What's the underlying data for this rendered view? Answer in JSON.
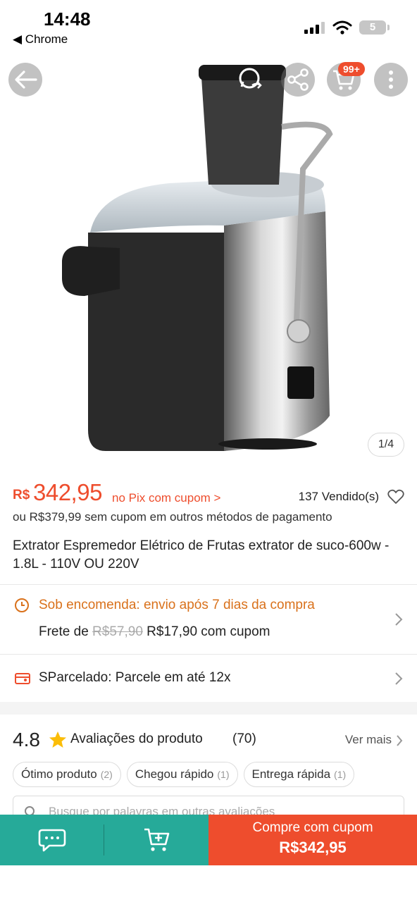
{
  "status_bar": {
    "time": "14:48",
    "back_app": "◀ Chrome",
    "battery": "5"
  },
  "hero": {
    "cart_badge": "99+",
    "pager": "1/4"
  },
  "price": {
    "currency": "R$",
    "value": "342,95",
    "pix_label": "no Pix com cupom >",
    "sold": "137 Vendido(s)",
    "alt": "ou R$379,99 sem cupom em outros métodos de pagamento"
  },
  "product": {
    "title": "Extrator Espremedor Elétrico de Frutas extrator de suco-600w - 1.8L - 110V OU 220V"
  },
  "shipping": {
    "title": "Sob encomenda: envio após 7 dias da compra",
    "frete_prefix": "Frete de",
    "frete_old": "R$57,90",
    "frete_new": "R$17,90 com cupom"
  },
  "installments": {
    "label": "SParcelado: Parcele em até 12x"
  },
  "reviews": {
    "rating": "4.8",
    "title": "Avaliações do produto",
    "count": "(70)",
    "see_more": "Ver mais",
    "chips": [
      {
        "label": "Ótimo produto",
        "n": "(2)"
      },
      {
        "label": "Chegou rápido",
        "n": "(1)"
      },
      {
        "label": "Entrega rápida",
        "n": "(1)"
      }
    ],
    "search_placeholder": "Busque por palavras em outras avaliações"
  },
  "bottom_bar": {
    "buy_line1": "Compre com cupom",
    "buy_line2": "R$342,95"
  },
  "colors": {
    "brand": "#ee4d2d",
    "teal": "#26aa99",
    "shipping": "#d9711b"
  }
}
